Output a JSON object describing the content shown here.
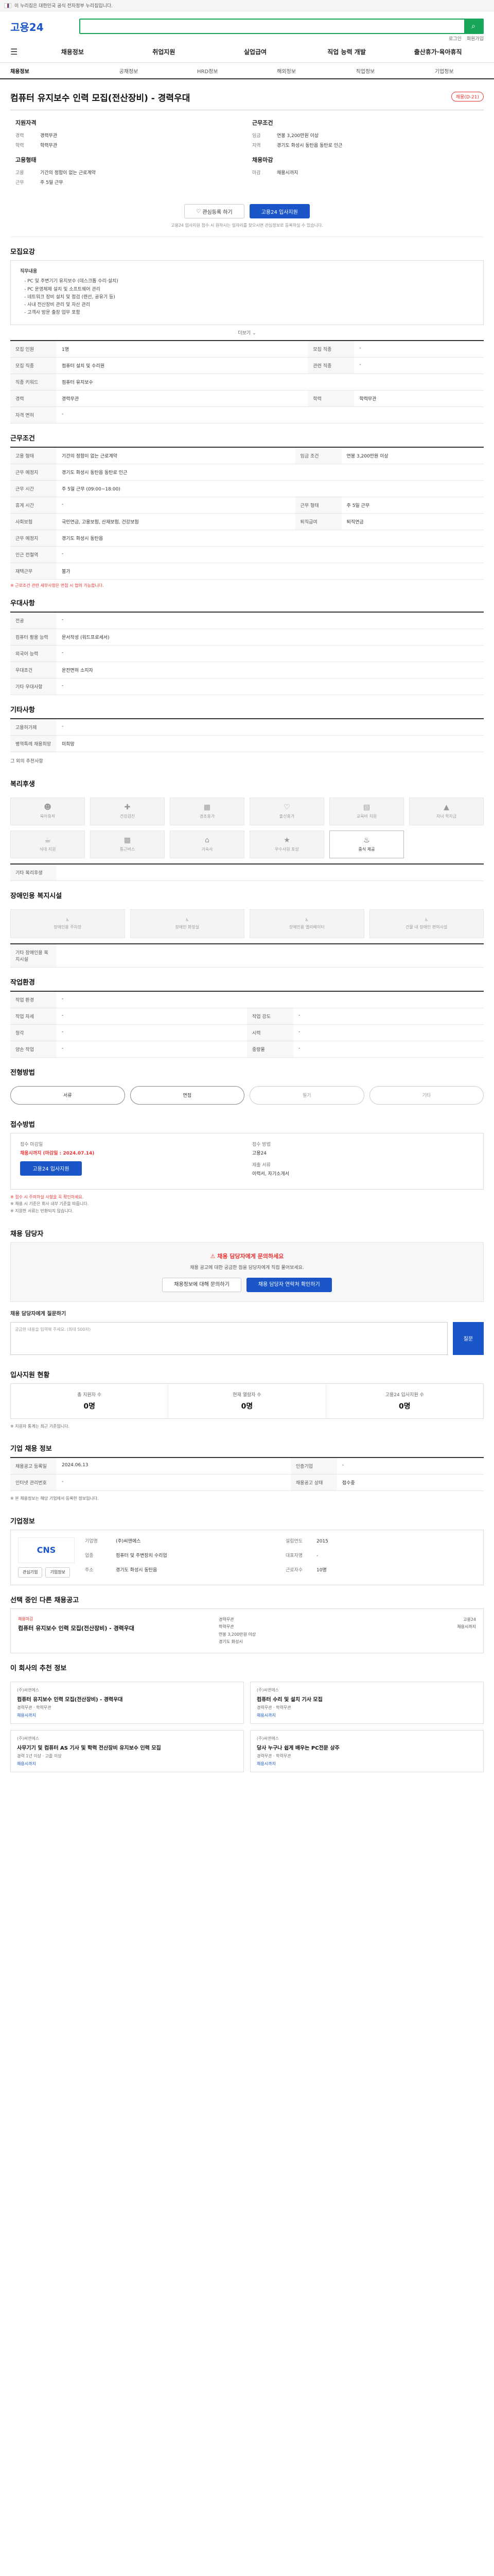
{
  "gov_banner": {
    "text": "이 누리집은 대한민국 공식 전자정부 누리집입니다.",
    "link": ""
  },
  "header": {
    "logo": "고용24",
    "search_placeholder": "",
    "util": [
      "로그인",
      "회원가입"
    ]
  },
  "gnb": [
    "채용정보",
    "취업지원",
    "실업급여",
    "직업 능력 개발",
    "출산휴가·육아휴직"
  ],
  "subnav": [
    "채용정보",
    "공채정보",
    "HRD정보",
    "해외정보",
    "직업정보",
    "기업정보"
  ],
  "job_title": "컴퓨터 유지보수 인력 모집(전산장비) - 경력우대",
  "title_badge": "채용(D-21)",
  "summary": {
    "col1_title": "지원자격",
    "col1": [
      {
        "k": "경력",
        "v": "경력무관"
      },
      {
        "k": "학력",
        "v": "학력무관"
      }
    ],
    "col2_title": "근무조건",
    "col2": [
      {
        "k": "임금",
        "v": "연봉 3,200만원 이상"
      },
      {
        "k": "지역",
        "v": "경기도 화성시 동탄읍 동탄로 인근"
      }
    ],
    "col3_title": "고용형태",
    "col3": [
      {
        "k": "고용",
        "v": "기간의 정함이 없는 근로계약"
      },
      {
        "k": "근무",
        "v": "주 5일 근무"
      }
    ],
    "col4_title": "채용마감",
    "col4": [
      {
        "k": "마감",
        "v": "채용시까지"
      }
    ]
  },
  "buttons": {
    "scrap": "관심등록 하기",
    "apply": "고용24 입사지원"
  },
  "summary_note": "고용24 입사지원 접수 시 원하시는 일자리를 찾으시면 관심정보로 등록하실 수 있습니다.",
  "sections": {
    "recruit": "모집요강",
    "conditions": "근무조건",
    "preference": "우대사항",
    "etc": "기타사항",
    "welfare": "복리후생",
    "facility": "장애인용 복지시설",
    "env": "작업환경",
    "process": "전형방법",
    "apply": "접수방법",
    "qna": "채용 담당자",
    "stats": "입사지원 현황",
    "info": "기업 채용 정보",
    "company": "기업정보",
    "compare": "선택 중인 다른 채용공고",
    "similar": "이 회사의 추천 정보"
  },
  "recruit_box": {
    "head": "직무내용",
    "lines": [
      "- PC 및 주변기기 유지보수 (데스크톱 수리·설치)",
      "- PC 운영체제 설치 및 소프트웨어 관리",
      "- 네트워크 장비 설치 및 점검 (랜선, 공유기 등)",
      "- 사내 전산장비 관리 및 자산 관리",
      "- 고객사 방문 출장 업무 포함"
    ],
    "more": "더보기"
  },
  "recruit_table": [
    [
      "모집 인원",
      "1명",
      "모집 직종",
      "-"
    ],
    [
      "모집 직종",
      "컴퓨터 설치 및 수리원",
      "관련 직종",
      "-"
    ],
    [
      "직종 키워드",
      "컴퓨터 유지보수",
      "",
      ""
    ],
    [
      "경력",
      "경력무관",
      "학력",
      "학력무관"
    ],
    [
      "자격 면허",
      "-",
      "",
      ""
    ]
  ],
  "cond_table": [
    [
      "고용 형태",
      "기간의 정함이 없는 근로계약",
      "임금 조건",
      "연봉 3,200만원 이상"
    ],
    [
      "근무 예정지",
      "경기도 화성시 동탄읍 동탄로 인근",
      "",
      ""
    ],
    [
      "근무 시간",
      "주 5일 근무 (09:00~18:00)",
      "",
      ""
    ],
    [
      "휴게 시간",
      "-",
      "근무 형태",
      "주 5일 근무"
    ],
    [
      "사회보험",
      "국민연금, 고용보험, 산재보험, 건강보험",
      "퇴직급여",
      "퇴직연금"
    ],
    [
      "근무 예정지",
      "경기도 화성시 동탄읍",
      "",
      ""
    ],
    [
      "인근 전철역",
      "-",
      "",
      ""
    ],
    [
      "재택근무",
      "불가",
      "",
      ""
    ]
  ],
  "cond_note": "※ 근로조건 관련 세부사항은 면접 시 협의 가능합니다.",
  "pref_table": [
    [
      "전공",
      "-",
      "",
      ""
    ],
    [
      "컴퓨터 활용 능력",
      "문서작성 (워드프로세서)",
      "",
      ""
    ],
    [
      "외국어 능력",
      "-",
      "",
      ""
    ],
    [
      "우대조건",
      "운전면허 소지자",
      "",
      ""
    ],
    [
      "기타 우대사항",
      "-",
      "",
      ""
    ]
  ],
  "etc_table": [
    [
      "고용허가제",
      "-",
      "",
      ""
    ],
    [
      "병역특례 채용희망",
      "미희망",
      "",
      ""
    ]
  ],
  "etc_extra": "그 외의 추천사항",
  "welfare_items": [
    {
      "name": "육아휴직",
      "icon": "baby-icon",
      "on": false
    },
    {
      "name": "건강검진",
      "icon": "health-icon",
      "on": false
    },
    {
      "name": "경조휴가",
      "icon": "calendar-icon",
      "on": false
    },
    {
      "name": "출산휴가",
      "icon": "heart-icon",
      "on": false
    },
    {
      "name": "교육비 지원",
      "icon": "book-icon",
      "on": false
    },
    {
      "name": "자녀 학자금",
      "icon": "grad-icon",
      "on": false
    },
    {
      "name": "식대 지원",
      "icon": "meal-icon",
      "on": false
    },
    {
      "name": "통근버스",
      "icon": "bus-icon",
      "on": false
    },
    {
      "name": "기숙사",
      "icon": "house-icon",
      "on": false
    },
    {
      "name": "우수사원 포상",
      "icon": "award-icon",
      "on": false
    },
    {
      "name": "중식 제공",
      "icon": "food-icon",
      "on": true
    }
  ],
  "welfare_other": "기타 복리후생",
  "facility_items": [
    "장애인용 주차장",
    "장애인 화장실",
    "장애인용 엘리베이터",
    "건물 내 장애인 편의시설"
  ],
  "facility_other": "기타 장애인용 복지시설",
  "env_table": [
    [
      "작업 환경",
      "-",
      "",
      ""
    ],
    [
      "작업 자세",
      "-",
      "작업 강도",
      "-"
    ],
    [
      "청각",
      "-",
      "시력",
      "-"
    ],
    [
      "양손 작업",
      "-",
      "중량물",
      "-"
    ]
  ],
  "process_steps": [
    {
      "label": "서류",
      "on": true
    },
    {
      "label": "면접",
      "on": true
    },
    {
      "label": "필기",
      "on": false
    },
    {
      "label": "기타",
      "on": false
    }
  ],
  "apply": {
    "period_lbl": "접수 마감일",
    "period_val": "채용시까지 (마감일 : 2024.07.14)",
    "method_lbl": "접수 방법",
    "method_val": "고용24",
    "docs_lbl": "제출 서류",
    "docs_val": "이력서, 자기소개서",
    "btn": "고용24 입사지원"
  },
  "apply_fine": [
    "※ 접수 시 주의하실 사항을 꼭 확인하세요.",
    "※ 채용 시 기준은 회사 내부 기준을 따릅니다.",
    "※ 지원한 서류는 반환되지 않습니다."
  ],
  "qna": {
    "hd": "채용 담당자에게 문의하세요",
    "text": "채용 공고에 대한 궁금한 점을 담당자에게 직접 물어보세요.",
    "btn1": "채용정보에 대해 문의하기",
    "btn2": "채용 담당자 연락처 확인하기"
  },
  "question": {
    "label": "채용 담당자에게 질문하기",
    "placeholder": "궁금한 내용을 입력해 주세요. (최대 500자)",
    "btn": "질문"
  },
  "stats": [
    {
      "label": "총 지원자 수",
      "num": "0명"
    },
    {
      "label": "현재 열람자 수",
      "num": "0명"
    },
    {
      "label": "고용24 입사지원 수",
      "num": "0명"
    }
  ],
  "stats_note": "※ 지원자 통계는 최근 기준입니다.",
  "info_table": [
    [
      "채용공고 등록일",
      "2024.06.13",
      "인증기업",
      "-"
    ],
    [
      "인터넷 관리번호",
      "-",
      "채용공고 상태",
      "접수중"
    ]
  ],
  "info_fine": "※ 본 채용정보는 해당 기업에서 등록한 정보입니다.",
  "company": {
    "logo": "CNS",
    "btn1": "관심기업",
    "btn2": "기업정보",
    "rows": [
      {
        "k": "기업명",
        "v": "(주)씨앤에스"
      },
      {
        "k": "설립연도",
        "v": "2015"
      },
      {
        "k": "업종",
        "v": "컴퓨터 및 주변장치 수리업"
      },
      {
        "k": "대표자명",
        "v": "-"
      },
      {
        "k": "주소",
        "v": "경기도 화성시 동탄읍"
      },
      {
        "k": "근로자수",
        "v": "10명"
      }
    ]
  },
  "compare": {
    "small": "채용마감",
    "title": "컴퓨터 유지보수 인력 모집(전산장비) - 경력우대",
    "conds": [
      "경력무관",
      "학력무관",
      "연봉 3,200만원 이상",
      "경기도 화성시"
    ],
    "aside": [
      "고용24",
      "채용시까지"
    ]
  },
  "similar": [
    {
      "co": "(주)씨앤에스",
      "title": "컴퓨터 유지보수 인력 모집(전산장비) - 경력우대",
      "meta": "경력무관 · 학력무관",
      "date": "채용시까지"
    },
    {
      "co": "(주)씨앤에스",
      "title": "컴퓨터 수리 및 설치 기사 모집",
      "meta": "경력무관 · 학력무관",
      "date": "채용시까지"
    },
    {
      "co": "(주)씨앤에스",
      "title": "사무기기 및 컴퓨터 AS 기사 및 학력 전산장비 유지보수 인력 모집",
      "meta": "경력 1년 이상 · 고졸 이상",
      "date": "채용시까지"
    },
    {
      "co": "(주)씨앤에스",
      "title": "당사 누구나 쉽게 배우는 PC전문 상주",
      "meta": "경력무관 · 학력무관",
      "date": "채용시까지"
    }
  ]
}
